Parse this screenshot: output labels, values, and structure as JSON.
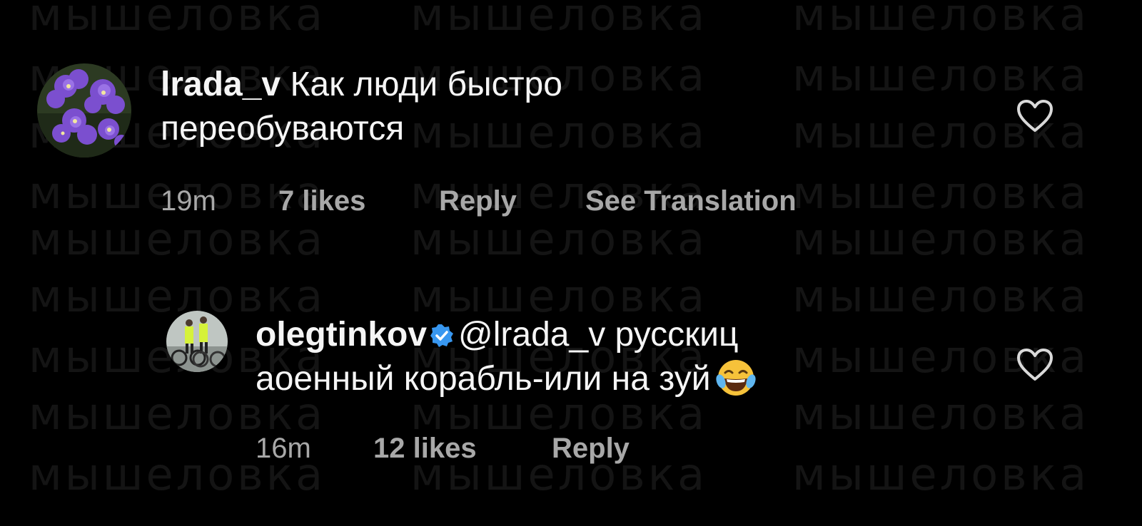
{
  "watermark": "мышеловка",
  "comments": [
    {
      "username": "lrada_v",
      "text_line1": "Как люди быстро",
      "text_line2": "переобуваются",
      "time": "19m",
      "likes": "7 likes",
      "reply": "Reply",
      "translate": "See Translation",
      "avatar_icon": "purple-flowers-avatar"
    },
    {
      "username": "olegtinkov",
      "verified": true,
      "mention": "@lrada_v",
      "text_line1_rest": "русскиц",
      "text_line2": "аоенный корабль-или на зуй",
      "emoji": "tears-of-joy-emoji",
      "time": "16m",
      "likes": "12 likes",
      "reply": "Reply",
      "avatar_icon": "cyclists-avatar"
    }
  ],
  "colors": {
    "background": "#000000",
    "text": "#f5f5f5",
    "meta": "#a8a8a8",
    "verified": "#3897f0",
    "watermark": "#141414"
  }
}
